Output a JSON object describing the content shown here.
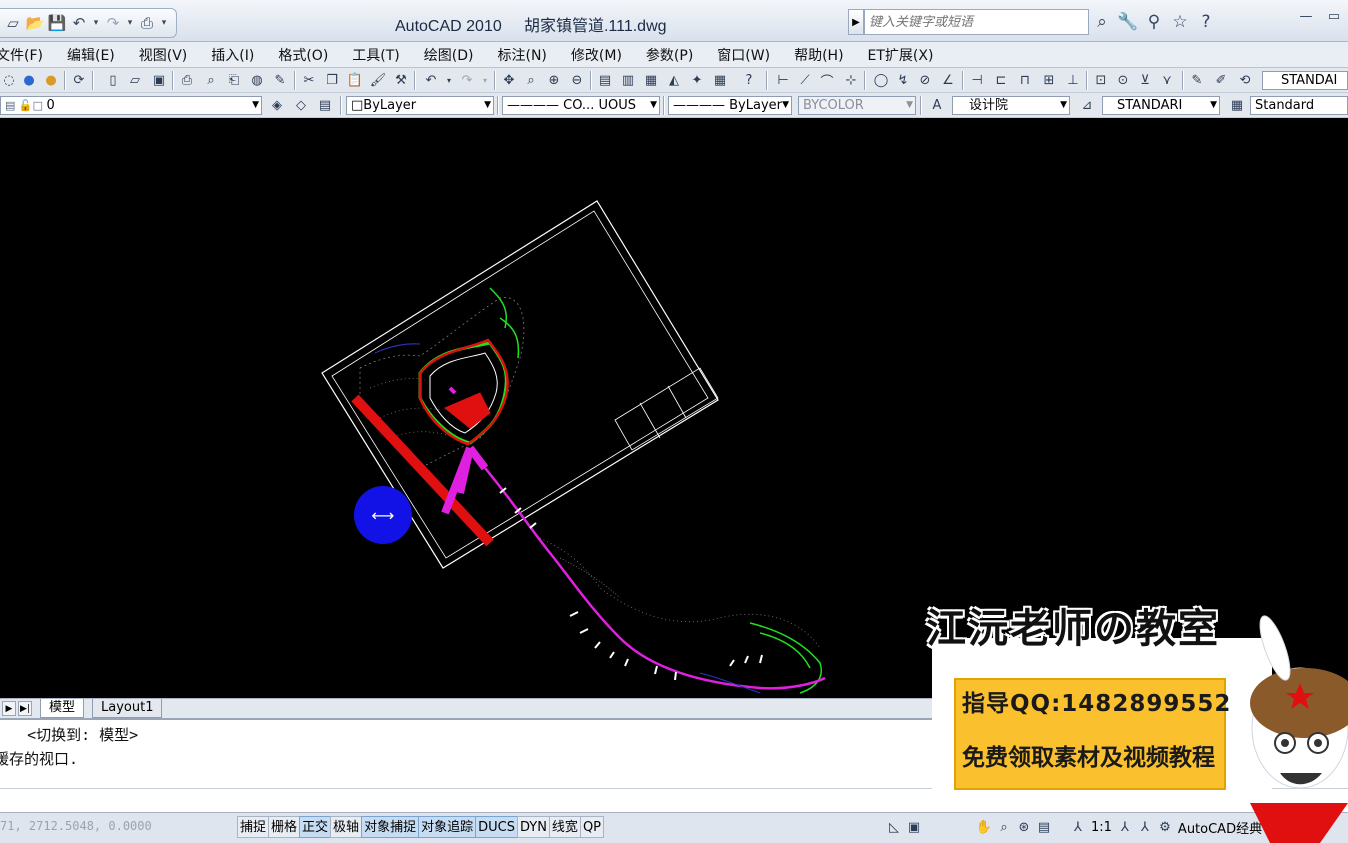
{
  "window": {
    "app_name": "AutoCAD 2010",
    "file_name": "胡家镇管道.111.dwg"
  },
  "infocenter": {
    "search_placeholder": "键入关键字或短语"
  },
  "menu": [
    "文件(F)",
    "编辑(E)",
    "视图(V)",
    "插入(I)",
    "格式(O)",
    "工具(T)",
    "绘图(D)",
    "标注(N)",
    "修改(M)",
    "参数(P)",
    "窗口(W)",
    "帮助(H)",
    "ET扩展(X)"
  ],
  "toolbar1": {
    "text_style_partial": "STANDAI"
  },
  "properties": {
    "layer": "0",
    "color": "ByLayer",
    "linetype": "CO... UOUS",
    "lineweight": "ByLayer",
    "plotstyle": "BYCOLOR",
    "dim_style": "设计院",
    "text_style": "STANDARI",
    "table_style": "Standard"
  },
  "layout_tabs": [
    "模型",
    "Layout1"
  ],
  "command_history": [
    "   <切换到: 模型>",
    "缓存的视口."
  ],
  "status": {
    "coords": "71, 2712.5048, 0.0000",
    "toggles": [
      {
        "label": "捕捉",
        "on": false
      },
      {
        "label": "栅格",
        "on": false
      },
      {
        "label": "正交",
        "on": true
      },
      {
        "label": "极轴",
        "on": false
      },
      {
        "label": "对象捕捉",
        "on": true
      },
      {
        "label": "对象追踪",
        "on": true
      },
      {
        "label": "DUCS",
        "on": true
      },
      {
        "label": "DYN",
        "on": false
      },
      {
        "label": "线宽",
        "on": false
      },
      {
        "label": "QP",
        "on": false
      }
    ],
    "scale": "1:1",
    "workspace": "AutoCAD",
    "workspace_suffix": "经典"
  },
  "watermark": {
    "title": "江沅老师の教室",
    "qq_line": "指导QQ:1482899552",
    "offer_line": "免费领取素材及视频教程"
  },
  "colors": {
    "background": "#000000",
    "road_red": "#e01010",
    "pipe_magenta": "#e020e0",
    "contour_green": "#20e020",
    "cursor_blue": "#1212e6"
  }
}
